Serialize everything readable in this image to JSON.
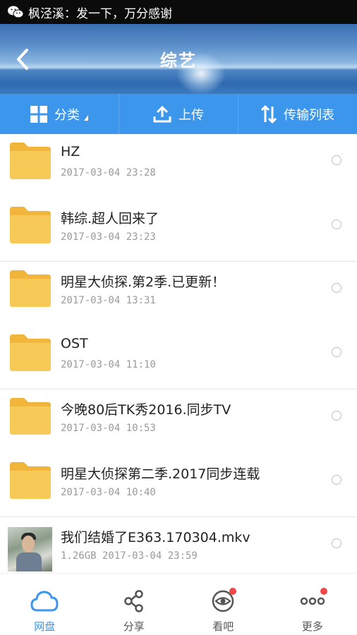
{
  "status_bar": {
    "text": "枫泾溪：发一下，万分感谢"
  },
  "header": {
    "title": "综艺"
  },
  "toolbar": {
    "category_label": "分类",
    "upload_label": "上传",
    "transfer_label": "传输列表"
  },
  "files": [
    {
      "name": "HZ",
      "meta": "2017-03-04  23:28",
      "type": "folder"
    },
    {
      "name": "韩综.超人回来了",
      "meta": "2017-03-04  23:23",
      "type": "folder"
    },
    {
      "name": "明星大侦探.第2季.已更新！",
      "meta": "2017-03-04  13:31",
      "type": "folder"
    },
    {
      "name": "OST",
      "meta": "2017-03-04  11:10",
      "type": "folder"
    },
    {
      "name": "今晚80后TK秀2016.同步TV",
      "meta": "2017-03-04  10:53",
      "type": "folder"
    },
    {
      "name": "明星大侦探第二季.2017同步连载",
      "meta": "2017-03-04  10:40",
      "type": "folder"
    },
    {
      "name": "我们结婚了E363.170304.mkv",
      "meta": "1.26GB  2017-03-04  23:59",
      "type": "video"
    }
  ],
  "bottom_nav": [
    {
      "label": "网盘",
      "icon": "cloud-icon",
      "active": true
    },
    {
      "label": "分享",
      "icon": "share-icon",
      "badge": false
    },
    {
      "label": "看吧",
      "icon": "eye-icon",
      "badge": true
    },
    {
      "label": "更多",
      "icon": "more-icon",
      "badge": true
    }
  ],
  "colors": {
    "accent": "#3c96ec",
    "folder": "#f5c24a",
    "badge": "#f04848"
  }
}
